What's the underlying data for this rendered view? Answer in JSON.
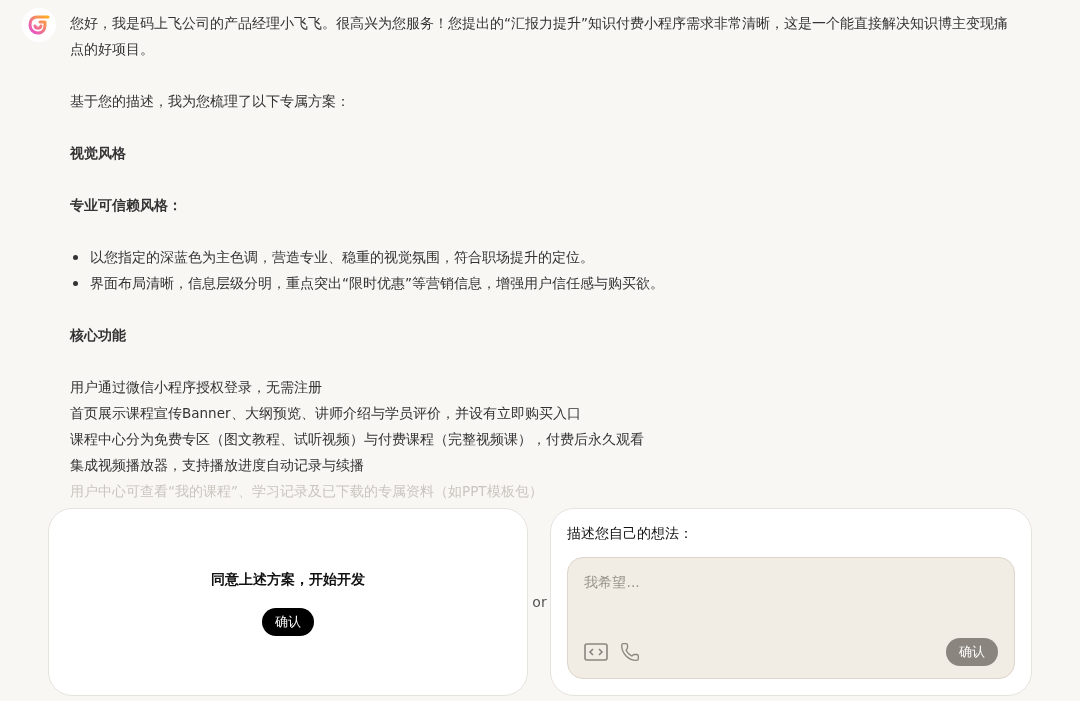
{
  "message": {
    "blocks": [
      {
        "kind": "paragraph",
        "text": "您好，我是码上飞公司的产品经理小飞飞。很高兴为您服务！您提出的“汇报力提升”知识付费小程序需求非常清晰，这是一个能直接解决知识博主变现痛点的好项目。"
      },
      {
        "kind": "paragraph",
        "text": "基于您的描述，我为您梳理了以下专属方案："
      },
      {
        "kind": "heading",
        "text": "视觉风格"
      },
      {
        "kind": "heading",
        "text": "专业可信赖风格："
      },
      {
        "kind": "bullets",
        "items": [
          "以您指定的深蓝色为主色调，营造专业、稳重的视觉氛围，符合职场提升的定位。",
          "界面布局清晰，信息层级分明，重点突出“限时优惠”等营销信息，增强用户信任感与购买欲。"
        ]
      },
      {
        "kind": "heading",
        "text": "核心功能"
      },
      {
        "kind": "lines",
        "items": [
          {
            "text": "用户通过微信小程序授权登录，无需注册",
            "faded": false
          },
          {
            "text": "首页展示课程宣传Banner、大纲预览、讲师介绍与学员评价，并设有立即购买入口",
            "faded": false
          },
          {
            "text": "课程中心分为免费专区（图文教程、试听视频）与付费课程（完整视频课），付费后永久观看",
            "faded": false
          },
          {
            "text": "集成视频播放器，支持播放进度自动记录与续播",
            "faded": false
          },
          {
            "text": "用户中心可查看“我的课程”、学习记录及已下载的专属资料（如PPT模板包）",
            "faded": true
          }
        ]
      }
    ]
  },
  "accept_card": {
    "title": "同意上述方案，开始开发",
    "button": "确认"
  },
  "separator": "or",
  "idea_card": {
    "title": "描述您自己的想法：",
    "placeholder": "我希望...",
    "button": "确认"
  }
}
